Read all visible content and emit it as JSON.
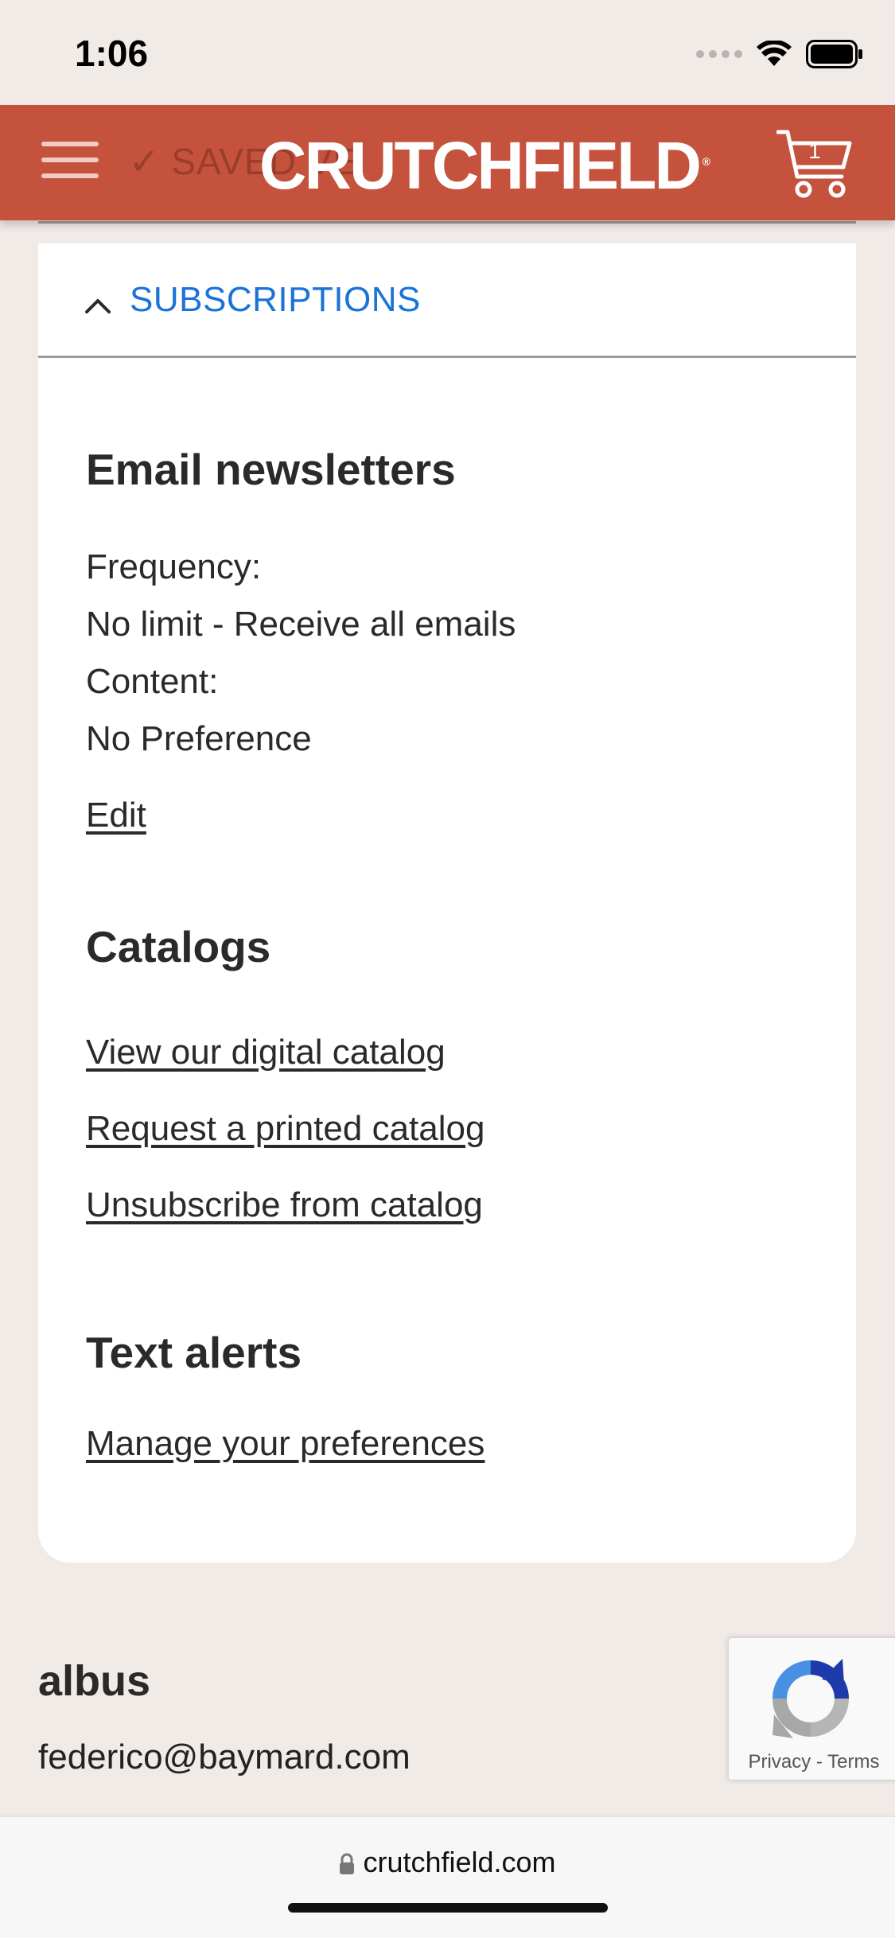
{
  "status_bar": {
    "time": "1:06"
  },
  "header": {
    "ghost_text": "✓ SAVED VE",
    "brand": "CRUTCHFIELD",
    "brand_mark": "®",
    "cart_count": "1",
    "brand_color": "#c4523d"
  },
  "subscriptions": {
    "section_title": "SUBSCRIPTIONS",
    "email": {
      "heading": "Email newsletters",
      "frequency_label": "Frequency:",
      "frequency_value": "No limit - Receive all emails",
      "content_label": "Content:",
      "content_value": "No Preference",
      "edit_link": "Edit"
    },
    "catalogs": {
      "heading": "Catalogs",
      "links": [
        "View our digital catalog",
        "Request a printed catalog",
        "Unsubscribe from catalog"
      ]
    },
    "text_alerts": {
      "heading": "Text alerts",
      "link": "Manage your preferences"
    }
  },
  "account": {
    "name": "albus",
    "email": "federico@baymard.com"
  },
  "recaptcha": {
    "privacy": "Privacy",
    "separator": " - ",
    "terms": "Terms"
  },
  "browser": {
    "url": "crutchfield.com"
  }
}
